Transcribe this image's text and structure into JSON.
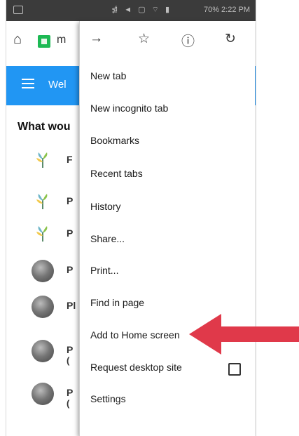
{
  "status_bar": {
    "text": "70% 2:22 PM",
    "icons": "⋬ ◄ ▢ ⌔ ▮"
  },
  "browser_toolbar": {
    "url_fragment": "m"
  },
  "web_header": {
    "title_fragment": "Wel"
  },
  "page": {
    "question_fragment": "What wou",
    "apps": [
      {
        "letter": "F",
        "sub": ""
      },
      {
        "letter": "P",
        "sub": ""
      },
      {
        "letter": "P",
        "sub": ""
      },
      {
        "letter": "P",
        "sub": ""
      },
      {
        "letter": "Pl",
        "sub": ""
      },
      {
        "letter": "P",
        "sub": "("
      },
      {
        "letter": "P",
        "sub": "("
      }
    ]
  },
  "menu": {
    "items": [
      "New tab",
      "New incognito tab",
      "Bookmarks",
      "Recent tabs",
      "History",
      "Share...",
      "Print...",
      "Find in page",
      "Add to Home screen",
      "Request desktop site",
      "Settings"
    ],
    "request_desktop_checked": false
  },
  "colors": {
    "header_blue": "#2196f3",
    "arrow_red": "#e0394a",
    "status_bar": "#3b3b3b"
  },
  "icons": [
    "home-icon",
    "forward-arrow-icon",
    "star-icon",
    "info-icon",
    "reload-icon",
    "hamburger-icon",
    "checkbox-icon",
    "red-arrow-icon"
  ]
}
